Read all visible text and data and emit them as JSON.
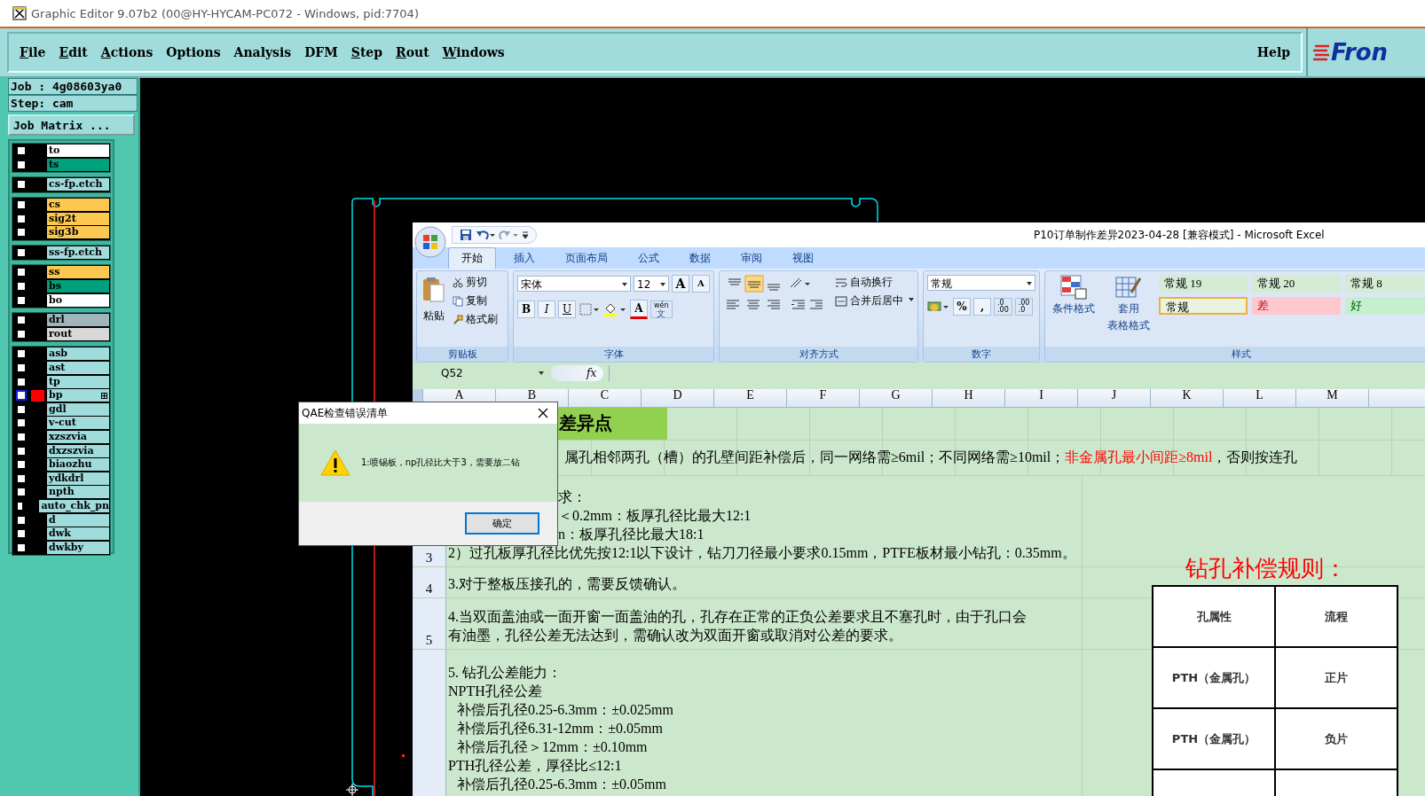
{
  "title_bar": {
    "title": "Graphic Editor 9.07b2 (00@HY-HYCAM-PC072 - Windows, pid:7704)"
  },
  "menu_bar": {
    "items": [
      {
        "label": "File",
        "underlined": true
      },
      {
        "label": "Edit",
        "underlined": true
      },
      {
        "label": "Actions",
        "underlined": true
      },
      {
        "label": "Options",
        "underlined": false
      },
      {
        "label": "Analysis",
        "underlined": false
      },
      {
        "label": "DFM",
        "underlined": false
      },
      {
        "label": "Step",
        "underlined": true
      },
      {
        "label": "Rout",
        "underlined": true
      },
      {
        "label": "Windows",
        "underlined": true
      }
    ],
    "help": "Help",
    "logo": "Fron"
  },
  "job_panel": {
    "job": "Job :  4g08603ya0",
    "step": "Step:  cam",
    "matrix_button": "Job Matrix ..."
  },
  "layer_groups": [
    [
      {
        "name": "to",
        "color": "#ffffff",
        "selected": false,
        "checked": false
      },
      {
        "name": "ts",
        "color": "#00a07c",
        "selected": false,
        "checked": false
      }
    ],
    [
      {
        "name": "cs-fp.etch",
        "color": "#a0dcdc",
        "selected": false,
        "checked": false
      }
    ],
    [
      {
        "name": "cs",
        "color": "#fcc850",
        "selected": false,
        "checked": false
      },
      {
        "name": "sig2t",
        "color": "#fcc850",
        "selected": false,
        "checked": false
      },
      {
        "name": "sig3b",
        "color": "#fcc850",
        "selected": false,
        "checked": false
      }
    ],
    [
      {
        "name": "ss-fp.etch",
        "color": "#a0dcdc",
        "selected": false,
        "checked": false
      }
    ],
    [
      {
        "name": "ss",
        "color": "#fcc850",
        "selected": false,
        "checked": false
      },
      {
        "name": "bs",
        "color": "#00a07c",
        "selected": false,
        "checked": false
      },
      {
        "name": "bo",
        "color": "#ffffff",
        "selected": false,
        "checked": false
      }
    ],
    [
      {
        "name": "drl",
        "color": "#a0b4bc",
        "selected": false,
        "checked": false
      },
      {
        "name": "rout",
        "color": "#d8d8d8",
        "selected": false,
        "checked": false
      }
    ],
    [
      {
        "name": "asb",
        "color": "#a0dcdc",
        "selected": false,
        "checked": false
      },
      {
        "name": "ast",
        "color": "#a0dcdc",
        "selected": false,
        "checked": false
      },
      {
        "name": "tp",
        "color": "#a0dcdc",
        "selected": false,
        "checked": false
      },
      {
        "name": "bp",
        "color": "#a0dcdc",
        "selected": true,
        "checked": false
      },
      {
        "name": "gdl",
        "color": "#a0dcdc",
        "selected": false,
        "checked": false
      },
      {
        "name": "v-cut",
        "color": "#a0dcdc",
        "selected": false,
        "checked": false
      },
      {
        "name": "xzszvia",
        "color": "#a0dcdc",
        "selected": false,
        "checked": false
      },
      {
        "name": "dxzszvia",
        "color": "#a0dcdc",
        "selected": false,
        "checked": false
      },
      {
        "name": "biaozhu",
        "color": "#a0dcdc",
        "selected": false,
        "checked": false
      },
      {
        "name": "ydkdrl",
        "color": "#a0dcdc",
        "selected": false,
        "checked": false
      },
      {
        "name": "npth",
        "color": "#a0dcdc",
        "selected": false,
        "checked": false
      },
      {
        "name": "auto_chk_pn",
        "color": "#a0dcdc",
        "selected": false,
        "checked": false
      },
      {
        "name": "d",
        "color": "#a0dcdc",
        "selected": false,
        "checked": false
      },
      {
        "name": "dwk",
        "color": "#a0dcdc",
        "selected": false,
        "checked": false
      },
      {
        "name": "dwkby",
        "color": "#a0dcdc",
        "selected": false,
        "checked": false
      }
    ]
  ],
  "excel": {
    "title": "P10订单制作差异2023-04-28  [兼容模式] - Microsoft Excel",
    "tabs": [
      {
        "label": "开始",
        "selected": true
      },
      {
        "label": "插入",
        "selected": false
      },
      {
        "label": "页面布局",
        "selected": false
      },
      {
        "label": "公式",
        "selected": false
      },
      {
        "label": "数据",
        "selected": false
      },
      {
        "label": "审阅",
        "selected": false
      },
      {
        "label": "视图",
        "selected": false
      }
    ],
    "clipboard": {
      "paste": "粘贴",
      "cut": "剪切",
      "copy": "复制",
      "painter": "格式刷",
      "label": "剪贴板"
    },
    "font": {
      "name": "宋体",
      "size": "12",
      "grow": "A",
      "shrink": "A",
      "bold": "B",
      "italic": "I",
      "underline": "U",
      "color_label": "A",
      "phonetic_top": "wén",
      "phonetic_bottom": "文",
      "label": "字体"
    },
    "alignment": {
      "wrap": "自动换行",
      "merge": "合并后居中",
      "label": "对齐方式"
    },
    "number": {
      "format": "常规",
      "percent": "%",
      "comma": ",",
      "inc_top": ".0",
      "inc_bottom": ".00",
      "dec_top": ".00",
      "dec_bottom": ".0",
      "label": "数字"
    },
    "styles": {
      "conditional": "条件格式",
      "table_top": "套用",
      "table_bottom": "表格格式",
      "label": "样式",
      "cells": [
        {
          "label": "常规 19",
          "kind": "normal",
          "selected": false
        },
        {
          "label": "常规 20",
          "kind": "normal",
          "selected": false
        },
        {
          "label": "常规 8",
          "kind": "normal",
          "selected": false
        },
        {
          "label": "常规",
          "kind": "normal",
          "selected": true
        },
        {
          "label": "差",
          "kind": "bad",
          "selected": false
        },
        {
          "label": "好",
          "kind": "good",
          "selected": false
        }
      ]
    },
    "name_box": "Q52",
    "fx": "fx",
    "columns": [
      "A",
      "B",
      "C",
      "D",
      "E",
      "F",
      "G",
      "H",
      "I",
      "J",
      "K",
      "L",
      "M"
    ],
    "rows": [
      {
        "kind": "title",
        "text": "差异点"
      },
      {
        "kind": "mixed",
        "segments": [
          {
            "text": "属孔相邻两孔（槽）的孔壁间距补偿后，同一网络需≥6mil；不同网络需≥10mil；",
            "highlight": false
          },
          {
            "text": "非金属孔最小间距≥8mil",
            "highlight": true
          },
          {
            "text": "，否则按连孔",
            "highlight": false
          }
        ]
      },
      {
        "kind": "block",
        "number": "3",
        "lines": [
          {
            "kind": "cut",
            "text": "求："
          },
          {
            "kind": "cut",
            "text": "＜0.2mm：板厚孔径比最大12:1"
          },
          {
            "kind": "cut",
            "text": "n：板厚孔径比最大18:1"
          },
          {
            "kind": "plain",
            "text": "2）过孔板厚孔径比优先按12:1以下设计，钻刀刀径最小要求0.15mm，PTFE板材最小钻孔：0.35mm。"
          }
        ]
      },
      {
        "kind": "block",
        "number": "4",
        "lines": [
          {
            "kind": "plain",
            "text": "3.对于整板压接孔的，需要反馈确认。"
          }
        ]
      },
      {
        "kind": "block",
        "number": "5",
        "lines": [
          {
            "kind": "plain",
            "text": "4.当双面盖油或一面开窗一面盖油的孔，孔存在正常的正负公差要求且不塞孔时，由于孔口会"
          },
          {
            "kind": "plain",
            "text": "有油墨，孔径公差无法达到，需确认改为双面开窗或取消对公差的要求。"
          }
        ]
      },
      {
        "kind": "block",
        "lines": [
          {
            "kind": "plain",
            "text": "5. 钻孔公差能力："
          },
          {
            "kind": "plain",
            "text": "NPTH孔径公差"
          },
          {
            "kind": "sub",
            "text": "补偿后孔径0.25-6.3mm：±0.025mm"
          },
          {
            "kind": "sub",
            "text": "补偿后孔径6.31-12mm：±0.05mm"
          },
          {
            "kind": "sub",
            "text": "补偿后孔径＞12mm：±0.10mm"
          },
          {
            "kind": "plain",
            "text": "PTH孔径公差，厚径比≤12:1"
          },
          {
            "kind": "sub",
            "text": "补偿后孔径0.25-6.3mm：±0.05mm"
          }
        ]
      }
    ],
    "rule_title": "钻孔补偿规则：",
    "rule_table": [
      [
        "孔属性",
        "流程"
      ],
      [
        "PTH（金属孔）",
        "正片"
      ],
      [
        "PTH（金属孔）",
        "负片"
      ]
    ]
  },
  "dialog": {
    "title": "QAE检查错误清单",
    "message": "1:喷锡板，np孔径比大于3，需要放二钻",
    "button": "确定"
  }
}
